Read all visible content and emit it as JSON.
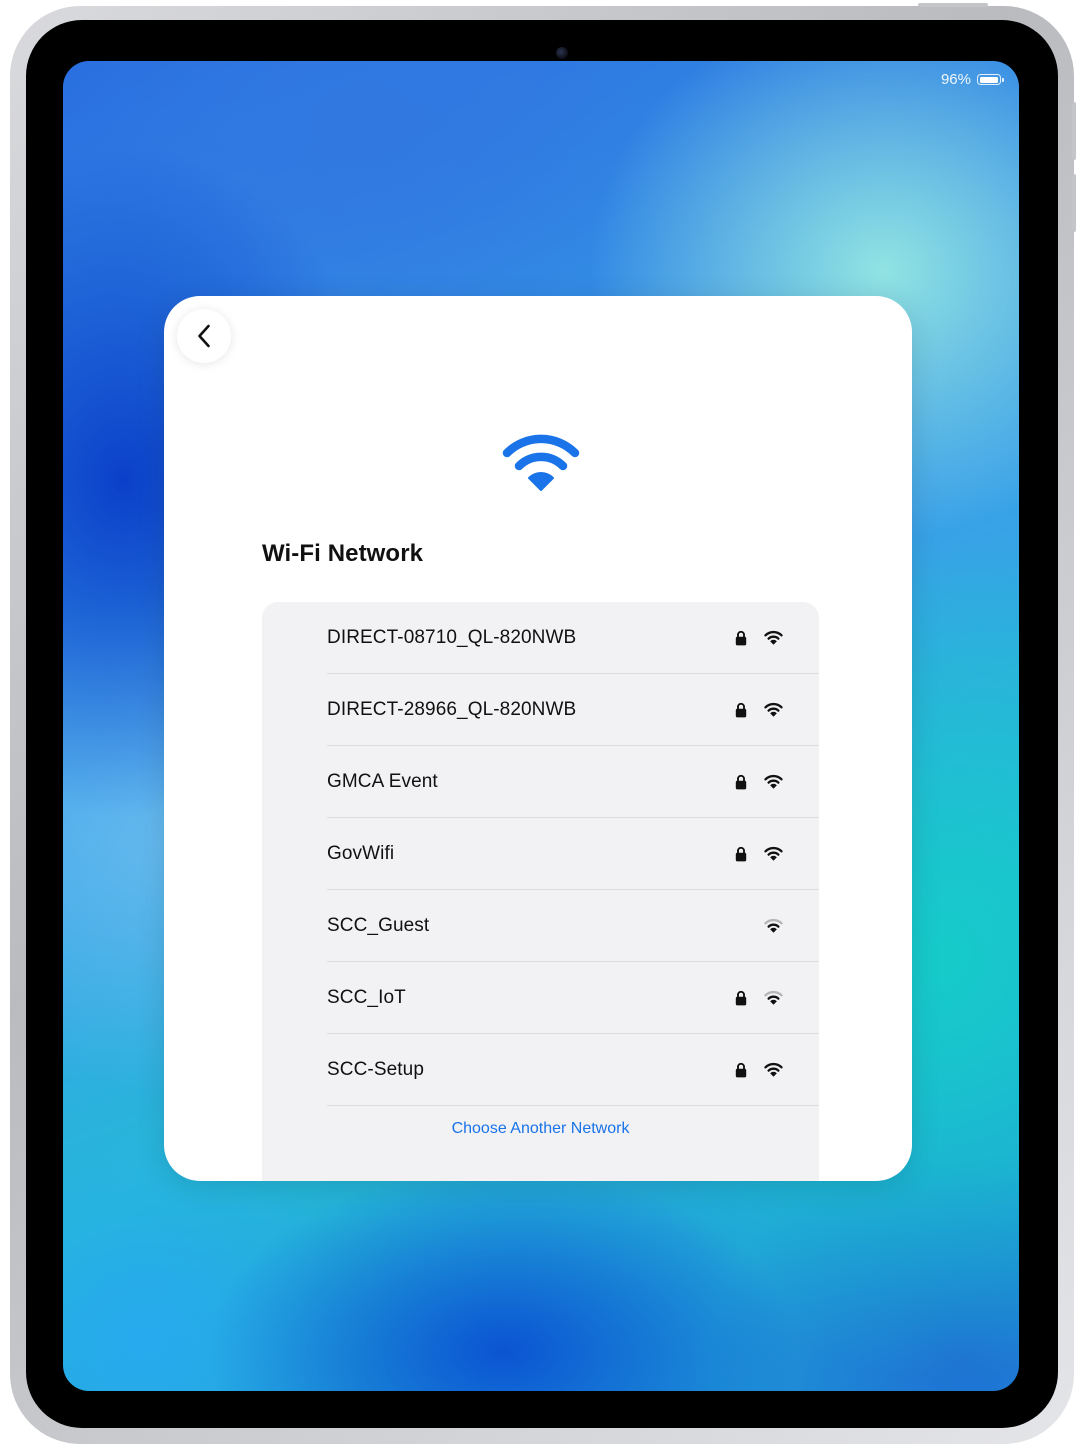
{
  "status_bar": {
    "battery_percent": "96%",
    "battery_level": 0.96
  },
  "sheet": {
    "back_icon": "chevron-left-icon",
    "hero_icon": "wifi-icon",
    "title": "Wi-Fi Network",
    "networks": [
      {
        "name": "DIRECT-08710_QL-820NWB",
        "secured": true,
        "signal_bars": 3
      },
      {
        "name": "DIRECT-28966_QL-820NWB",
        "secured": true,
        "signal_bars": 3
      },
      {
        "name": "GMCA Event",
        "secured": true,
        "signal_bars": 3
      },
      {
        "name": "GovWifi",
        "secured": true,
        "signal_bars": 3
      },
      {
        "name": "SCC_Guest",
        "secured": false,
        "signal_bars": 2
      },
      {
        "name": "SCC_IoT",
        "secured": true,
        "signal_bars": 2
      },
      {
        "name": "SCC-Setup",
        "secured": true,
        "signal_bars": 3
      }
    ],
    "choose_another": "Choose Another Network"
  },
  "colors": {
    "accent": "#1a73e8",
    "wifi_hero": "#1a73e8",
    "list_background": "#f2f2f4",
    "sheet_background": "#ffffff"
  }
}
